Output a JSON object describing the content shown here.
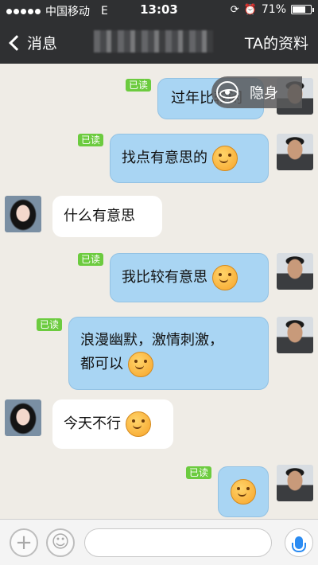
{
  "status_bar": {
    "carrier": "中国移动",
    "network": "E",
    "time": "13:03",
    "battery": "71%",
    "battery_level": 0.71
  },
  "nav": {
    "back_label": "消息",
    "profile_label": "TA的资料"
  },
  "stealth": {
    "label": "隐身"
  },
  "messages": [
    {
      "side": "out",
      "text": "过年比较闲",
      "read": "已读"
    },
    {
      "side": "out",
      "text": "找点有意思的",
      "read": "已读",
      "emoji": true
    },
    {
      "side": "in",
      "text": "什么有意思"
    },
    {
      "side": "out",
      "text": "我比较有意思",
      "read": "已读",
      "emoji": true
    },
    {
      "side": "out",
      "text": "浪漫幽默，激情刺激，",
      "text2": "都可以",
      "read": "已读",
      "emoji": true
    },
    {
      "side": "in",
      "text": "今天不行",
      "emoji": true
    },
    {
      "side": "out",
      "text": "",
      "read": "已读",
      "emoji": true
    }
  ]
}
